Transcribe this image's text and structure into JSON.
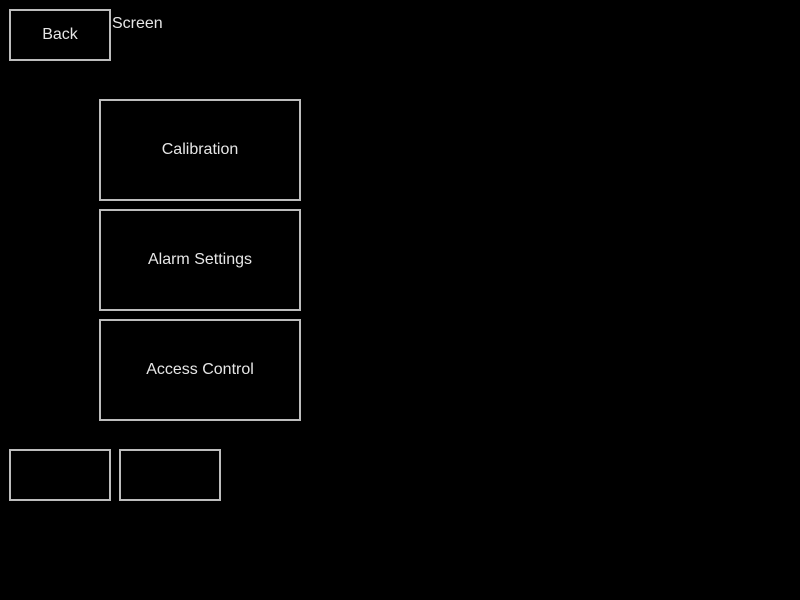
{
  "header": {
    "back_label": "Back",
    "title": "Screen"
  },
  "menu": {
    "items": [
      {
        "label": "Calibration"
      },
      {
        "label": "Alarm Settings"
      },
      {
        "label": "Access Control"
      }
    ]
  },
  "footer": {
    "buttons": [
      {
        "label": ""
      },
      {
        "label": ""
      }
    ]
  },
  "colors": {
    "background": "#000000",
    "border": "#bdbdbd",
    "text": "#e6e6e6"
  }
}
